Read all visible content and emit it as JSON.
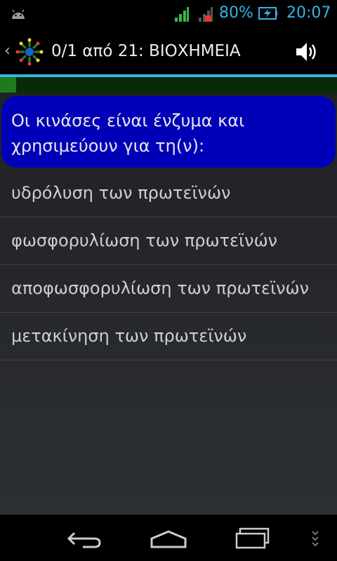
{
  "status_bar": {
    "battery_percent": "80%",
    "time": "20:07",
    "accent_color": "#33b5e5"
  },
  "action_bar": {
    "title": "0/1 από 21: ΒΙΟΧΗΜΕΙΑ",
    "icons": [
      "back-chevron",
      "app-logo",
      "speaker-icon"
    ]
  },
  "progress": {
    "fraction": 0.048,
    "color": "#1f7a1f"
  },
  "question": {
    "text": "Οι κινάσες είναι ένζυμα και χρησιμεύουν για τη(ν):",
    "bubble_color": "#0000b8"
  },
  "answers": [
    {
      "text": "υδρόλυση των πρωτεϊνών"
    },
    {
      "text": "φωσφορυλίωση των πρωτεϊνών"
    },
    {
      "text": "αποφωσφορυλίωση των πρωτεϊνών"
    },
    {
      "text": "μετακίνηση των πρωτεϊνών"
    }
  ],
  "nav_bar": {
    "icons": [
      "back-icon",
      "home-icon",
      "recent-apps-icon",
      "menu-icon"
    ]
  }
}
